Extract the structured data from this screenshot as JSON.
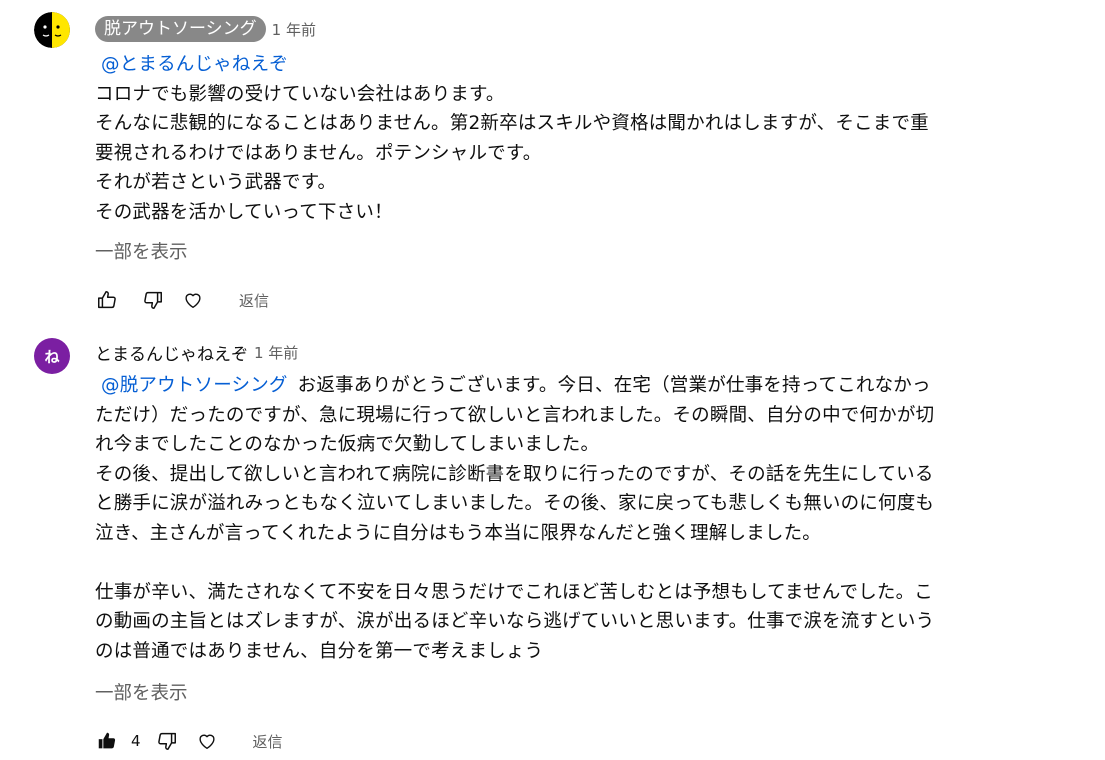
{
  "comments": [
    {
      "author": "脱アウトソーシング",
      "time": "1 年前",
      "mention": "@とまるんじゃねえぞ",
      "lines": [
        "コロナでも影響の受けていない会社はあります。",
        "そんなに悲観的になることはありません。第2新卒はスキルや資格は聞かれはしますが、そこまで重",
        "要視されるわけではありません。ポテンシャルです。",
        "それが若さという武器です。",
        "その武器を活かしていって下さい！"
      ],
      "show_more": "一部を表示",
      "like_count": "",
      "reply_label": "返信"
    },
    {
      "author": "とまるんじゃねえぞ",
      "avatar_letter": "ね",
      "avatar_color": "#7b1fa2",
      "time": "1 年前",
      "mention": "@脱アウトソーシング",
      "first_line_rest": "お返事ありがとうございます。今日、在宅（営業が仕事を持ってこれなかっ",
      "lines": [
        "ただけ）だったのですが、急に現場に行って欲しいと言われました。その瞬間、自分の中で何かが切",
        "れ今までしたことのなかった仮病で欠勤してしまいました。",
        "その後、提出して欲しいと言われて病院に診断書を取りに行ったのですが、その話を先生にしている",
        "と勝手に涙が溢れみっともなく泣いてしまいました。その後、家に戻っても悲しくも無いのに何度も",
        "泣き、主さんが言ってくれたように自分はもう本当に限界なんだと強く理解しました。",
        "",
        "仕事が辛い、満たされなくて不安を日々思うだけでこれほど苦しむとは予想もしてませんでした。こ",
        "の動画の主旨とはズレますが、涙が出るほど辛いなら逃げていいと思います。仕事で涙を流すという",
        "のは普通ではありません、自分を第一で考えましょう"
      ],
      "show_more": "一部を表示",
      "like_count": "4",
      "reply_label": "返信"
    }
  ],
  "icons": [
    "thumb-up-icon",
    "thumb-down-icon",
    "heart-icon"
  ]
}
